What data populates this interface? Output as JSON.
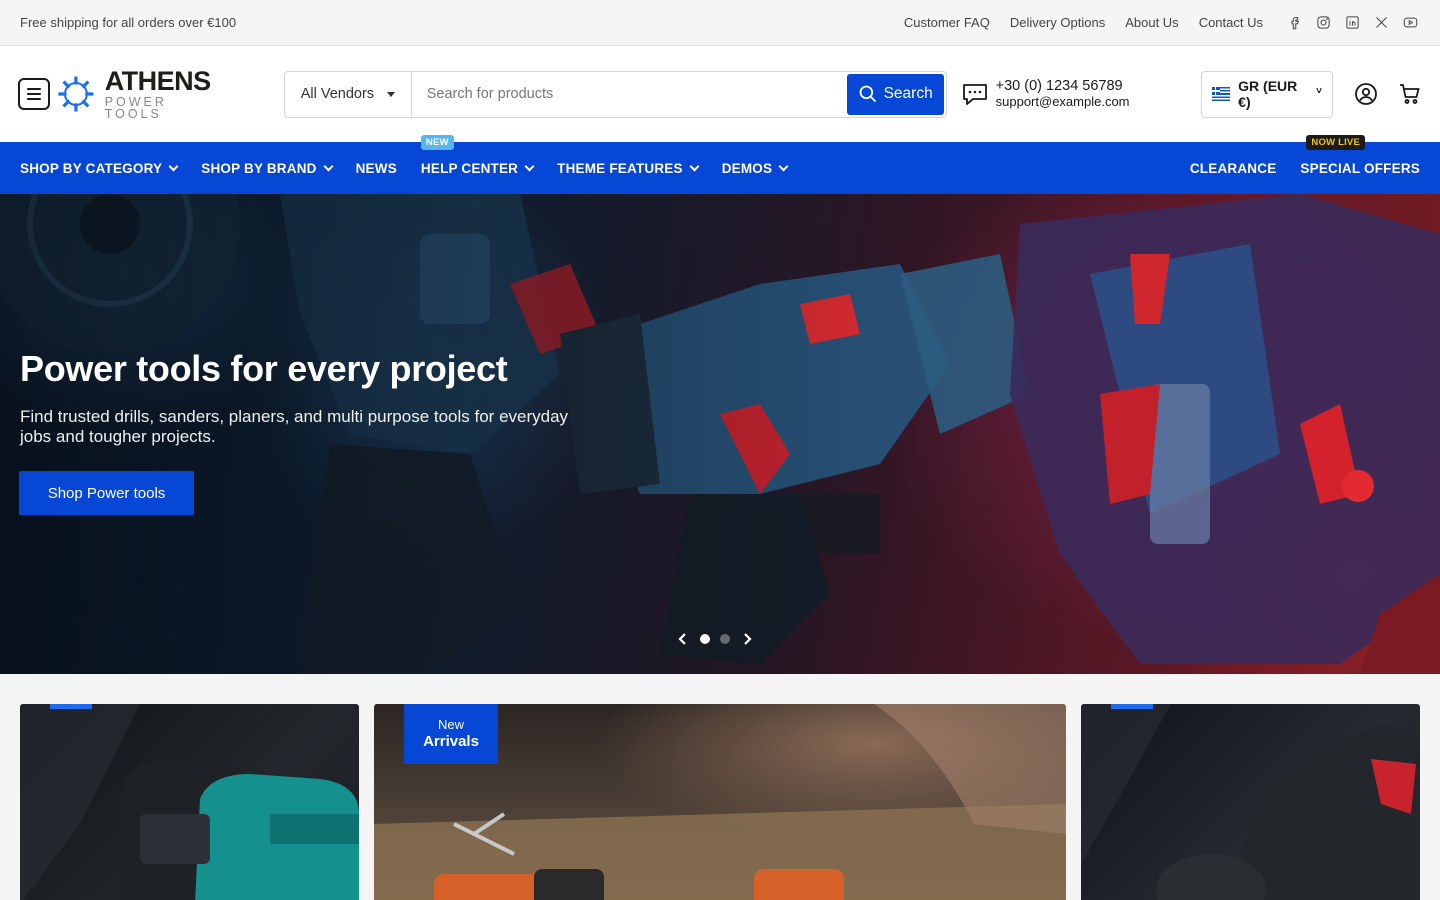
{
  "topbar": {
    "announcement": "Free shipping for all orders over €100",
    "links": [
      "Customer FAQ",
      "Delivery Options",
      "About Us",
      "Contact Us"
    ],
    "social": [
      "facebook-icon",
      "instagram-icon",
      "linkedin-icon",
      "x-icon",
      "youtube-icon"
    ]
  },
  "header": {
    "logo_main": "ATHENS",
    "logo_sub": "POWER TOOLS",
    "vendor_select": "All Vendors",
    "search_placeholder": "Search for products",
    "search_button": "Search",
    "phone": "+30 (0) 1234 56789",
    "email": "support@example.com",
    "currency": "GR (EUR €)"
  },
  "nav": {
    "left": [
      {
        "label": "SHOP BY CATEGORY",
        "dropdown": true
      },
      {
        "label": "SHOP BY BRAND",
        "dropdown": true
      },
      {
        "label": "NEWS",
        "dropdown": false
      },
      {
        "label": "HELP CENTER",
        "dropdown": true,
        "badge": "NEW"
      },
      {
        "label": "THEME FEATURES",
        "dropdown": true
      },
      {
        "label": "DEMOS",
        "dropdown": true
      }
    ],
    "right": [
      {
        "label": "CLEARANCE"
      },
      {
        "label": "SPECIAL OFFERS",
        "badge": "NOW LIVE"
      }
    ]
  },
  "hero": {
    "title": "Power tools for every project",
    "subtitle": "Find trusted drills, sanders, planers, and multi purpose tools for everyday jobs and tougher projects.",
    "button": "Shop Power tools",
    "slides": 2,
    "active_slide": 1
  },
  "promos": {
    "card2_tag_line1": "New",
    "card2_tag_line2": "Arrivals"
  },
  "colors": {
    "brand_blue": "#0747d6",
    "new_badge": "#5ab5ef",
    "live_badge_bg": "#1b1b1b",
    "live_badge_text": "#f0c419"
  }
}
